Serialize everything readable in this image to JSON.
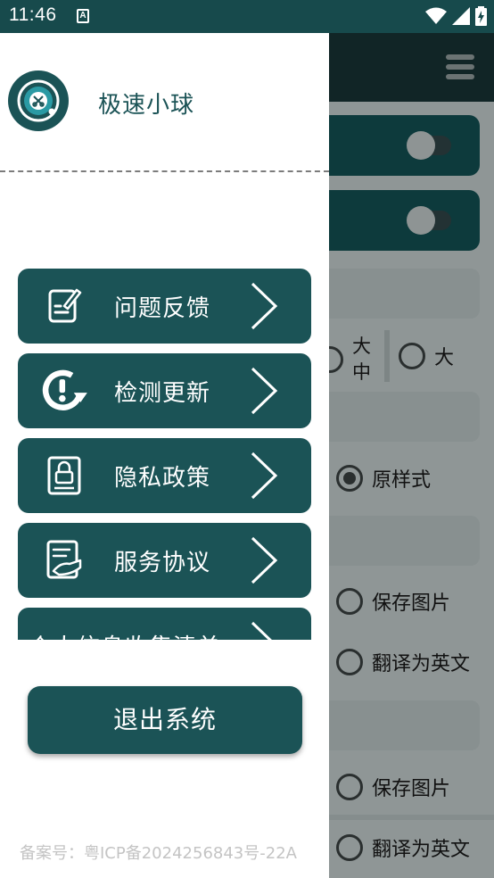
{
  "status_bar": {
    "time": "11:46",
    "notification_icon": "A",
    "icons": [
      "wifi-icon",
      "signal-icon",
      "battery-charging-icon"
    ]
  },
  "drawer": {
    "app_name": "极速小球",
    "menu_items": [
      {
        "label": "问题反馈",
        "icon": "feedback-edit-icon"
      },
      {
        "label": "检测更新",
        "icon": "check-update-icon"
      },
      {
        "label": "隐私政策",
        "icon": "privacy-lock-icon"
      },
      {
        "label": "服务协议",
        "icon": "service-agreement-icon"
      },
      {
        "label": "个人信息收集清单",
        "icon": ""
      }
    ],
    "logout_label": "退出系统",
    "icp_text": "备案号：粤ICP备2024256843号-22A"
  },
  "background_app": {
    "size_options": [
      "大中",
      "大"
    ],
    "style_option": "原样式",
    "save_image": "保存图片",
    "translate_english": "翻译为英文",
    "save_image_2": "保存图片",
    "translate_english_2": "翻译为英文"
  },
  "colors": {
    "primary": "#1b5356",
    "status_bar": "#174a4c",
    "scrim": "#8f9696"
  }
}
